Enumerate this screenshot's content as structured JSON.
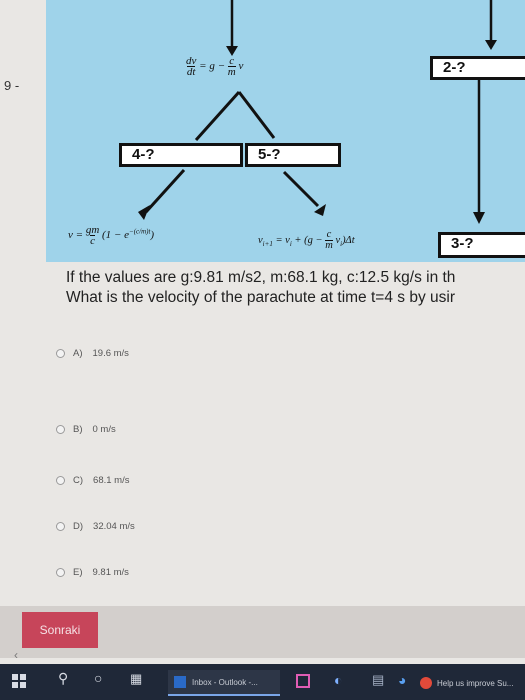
{
  "question_number": "9 -",
  "diagram": {
    "boxes": {
      "box_2": "2-?",
      "box_3": "3-?",
      "box_4": "4-?",
      "box_5": "5-?"
    },
    "equations": {
      "top_lhs_num": "dv",
      "top_lhs_den": "dt",
      "top_rhs": "= g −",
      "top_frac_num": "c",
      "top_frac_den": "m",
      "top_var": "v",
      "left_prefix": "v =",
      "left_frac_num": "gm",
      "left_frac_den": "c",
      "left_rest": "(1 − e",
      "left_exp": "−(c/m)t",
      "left_close": ")",
      "right_main": "v",
      "right_sub1": "i+1",
      "right_eq": "= v",
      "right_sub2": "i",
      "right_plus": "+ (g −",
      "right_frac_num": "c",
      "right_frac_den": "m",
      "right_v": "v",
      "right_sub3": "i",
      "right_end": ")Δt"
    }
  },
  "question": {
    "line1": "If the values are g:9.81 m/s2, m:68.1 kg, c:12.5 kg/s in th",
    "line2": "What is the velocity of the parachute at time t=4 s by usir"
  },
  "options": [
    {
      "letter": "A)",
      "text": "19.6 m/s"
    },
    {
      "letter": "B)",
      "text": "0 m/s"
    },
    {
      "letter": "C)",
      "text": "68.1 m/s"
    },
    {
      "letter": "D)",
      "text": "32.04 m/s"
    },
    {
      "letter": "E)",
      "text": "9.81 m/s"
    }
  ],
  "next_button": "Sonraki",
  "taskbar": {
    "inbox_label": "Inbox - Outlook -...",
    "help_label": "Help us improve Su..."
  }
}
